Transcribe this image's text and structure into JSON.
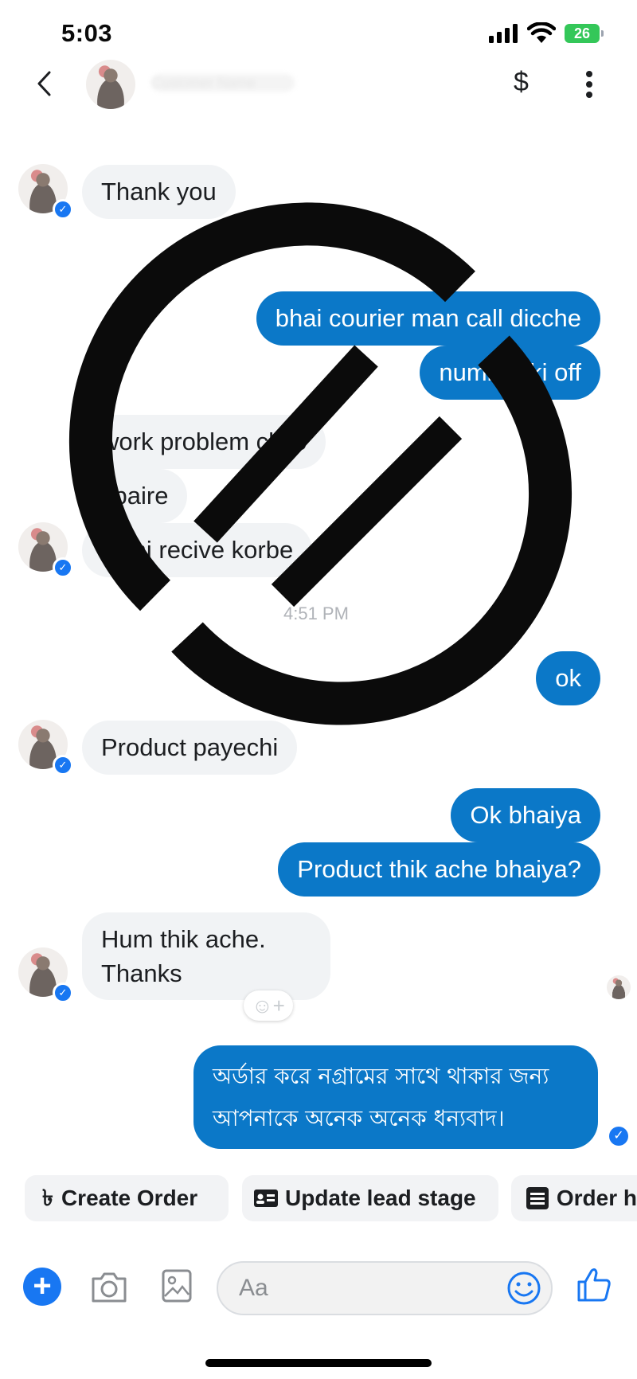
{
  "status_bar": {
    "time": "5:03",
    "battery": "26"
  },
  "header": {
    "contact_name": "Customer Name",
    "dollar_icon": "$"
  },
  "messages": {
    "m1": "Thank you",
    "m2": "bhai courier man call dicche",
    "m3": "number ki off",
    "m4": "work problem chilo",
    "m5": "i baire",
    "m6": "dichi recive korbe",
    "time": "4:51 PM",
    "m7": "ok",
    "m8": "Product payechi",
    "m9": "Ok bhaiya",
    "m10": "Product thik ache bhaiya?",
    "m11_line1": "Hum thik ache.",
    "m11_line2": "Thanks",
    "m12_line1": "অর্ডার করে নগ্রামের সাথে থাকার জন্য",
    "m12_line2": "আপনাকে অনেক অনেক ধন্যবাদ।"
  },
  "actions": {
    "create_order": "Create Order",
    "update_lead": "Update lead stage",
    "order_history": "Order h"
  },
  "composer": {
    "placeholder": "Aa"
  },
  "colors": {
    "outgoing": "#0b78c8",
    "incoming": "#f1f3f5",
    "accent": "#1877f2"
  }
}
